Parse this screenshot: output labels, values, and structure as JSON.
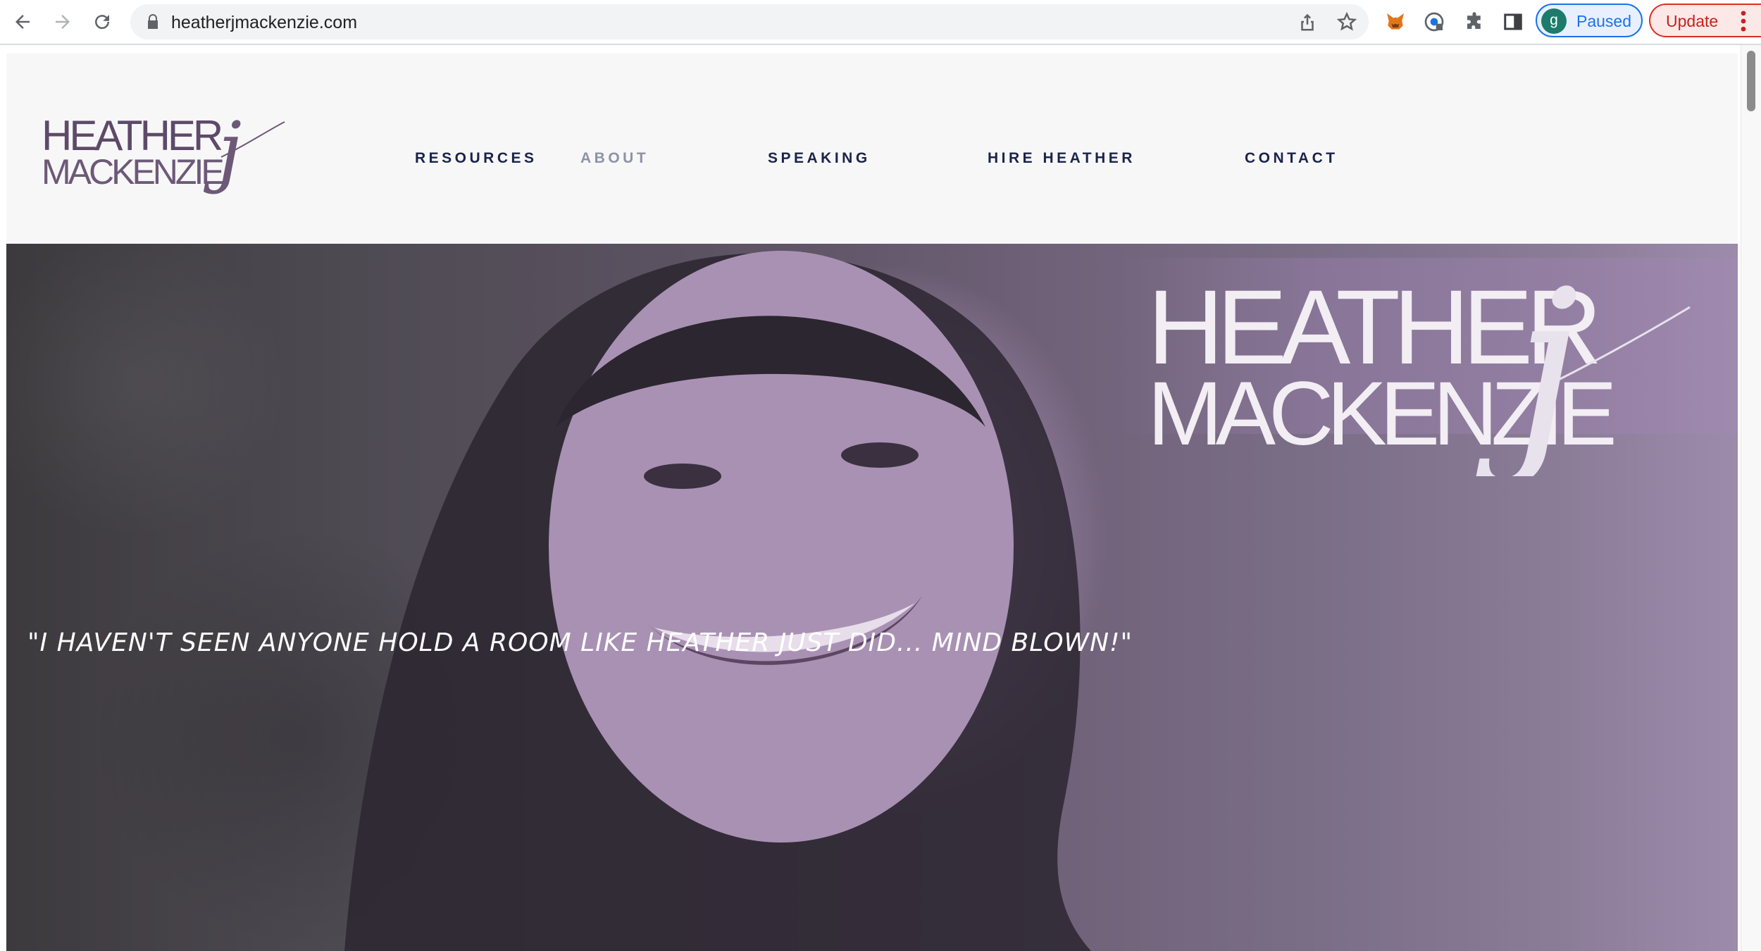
{
  "browser": {
    "url": "heatherjmackenzie.com",
    "profile_initial": "g",
    "profile_status": "Paused",
    "update_label": "Update",
    "icons": [
      "back-icon",
      "forward-icon",
      "reload-icon",
      "lock-icon",
      "share-icon",
      "star-icon",
      "metamask-icon",
      "extension-icon",
      "puzzle-icon",
      "side-panel-icon",
      "menu-dots-icon"
    ]
  },
  "site": {
    "logo_line1": "HEATHER",
    "logo_line2": "MACKENZIE",
    "logo_j": "j",
    "nav": [
      {
        "label": "RESOURCES",
        "state": "default"
      },
      {
        "label": "ABOUT",
        "state": "muted"
      },
      {
        "label": "SPEAKING",
        "state": "default"
      },
      {
        "label": "HIRE HEATHER",
        "state": "default"
      },
      {
        "label": "CONTACT",
        "state": "default"
      }
    ],
    "colors": {
      "nav_text": "#1b2448",
      "nav_muted": "#8e92a3",
      "logo_purple": "#5e4a68",
      "hero_tint": "#9b83a6"
    }
  },
  "hero": {
    "logo_line1": "HEATHER",
    "logo_line2": "MACKENZIE",
    "logo_j": "j",
    "quote": "\"I HAVEN'T SEEN ANYONE HOLD A ROOM LIKE HEATHER JUST DID... MIND BLOWN!\""
  }
}
